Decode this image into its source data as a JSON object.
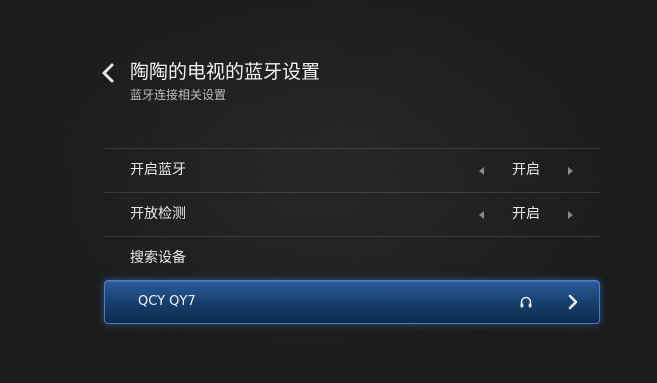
{
  "header": {
    "title": "陶陶的电视的蓝牙设置",
    "subtitle": "蓝牙连接相关设置"
  },
  "settings": [
    {
      "label": "开启蓝牙",
      "value": "开启"
    },
    {
      "label": "开放检测",
      "value": "开启"
    }
  ],
  "search": {
    "label": "搜索设备"
  },
  "device": {
    "name": "QCY QY7",
    "icon": "headphone-icon"
  },
  "colors": {
    "accent": "#3e7fd0",
    "background": "#1c1c1c"
  }
}
